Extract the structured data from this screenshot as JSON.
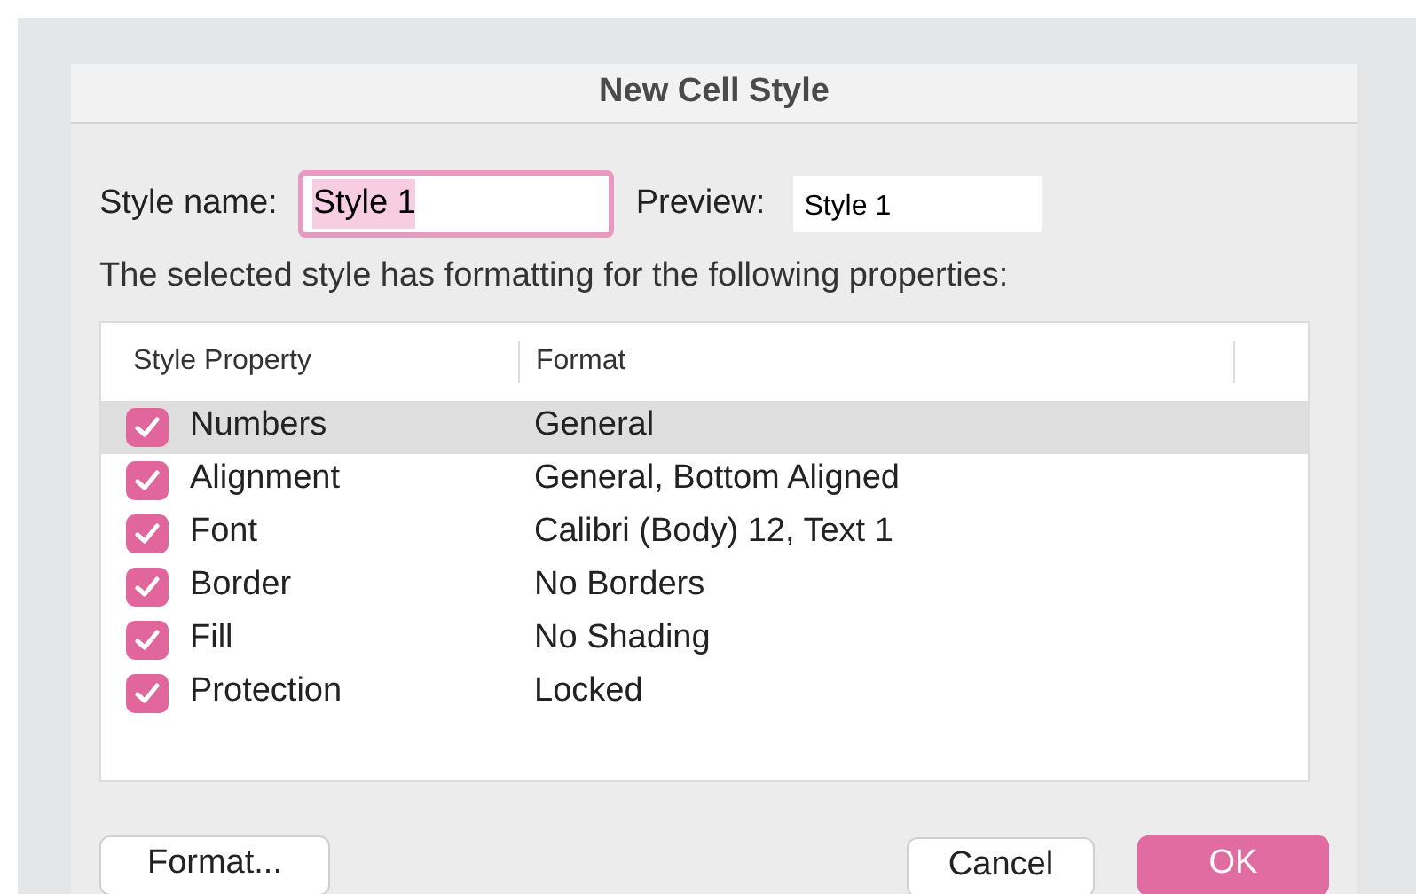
{
  "window": {
    "title": "New Cell Style"
  },
  "style_name": {
    "label": "Style name:",
    "value": "Style 1"
  },
  "preview": {
    "label": "Preview:",
    "text": "Style 1"
  },
  "description": "The selected style has formatting for the following properties:",
  "table": {
    "columns": [
      "Style Property",
      "Format"
    ],
    "rows": [
      {
        "property": "Numbers",
        "format": "General",
        "checked": true,
        "selected": true
      },
      {
        "property": "Alignment",
        "format": "General, Bottom Aligned",
        "checked": true,
        "selected": false
      },
      {
        "property": "Font",
        "format": "Calibri (Body) 12, Text 1",
        "checked": true,
        "selected": false
      },
      {
        "property": "Border",
        "format": "No Borders",
        "checked": true,
        "selected": false
      },
      {
        "property": "Fill",
        "format": "No Shading",
        "checked": true,
        "selected": false
      },
      {
        "property": "Protection",
        "format": "Locked",
        "checked": true,
        "selected": false
      }
    ]
  },
  "buttons": {
    "format": "Format...",
    "cancel": "Cancel",
    "ok": "OK"
  }
}
